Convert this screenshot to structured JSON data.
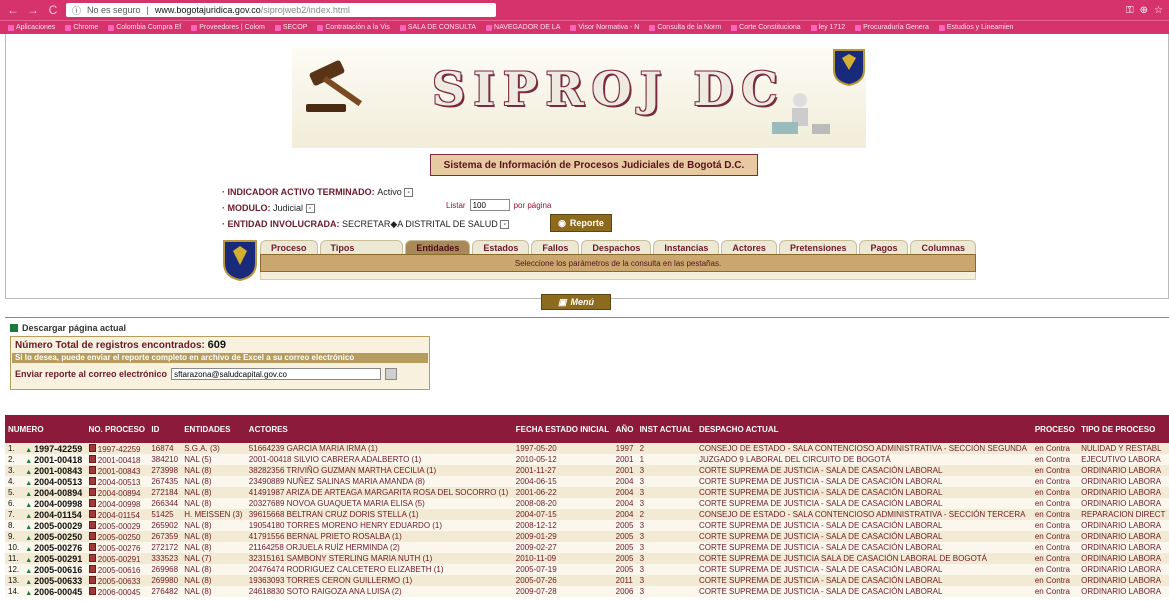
{
  "browser": {
    "security_label": "No es seguro",
    "url_host": "www.bogotajuridica.gov.co",
    "url_path": "/siprojweb2/index.html",
    "bookmarks": [
      "Aplicaciones",
      "Chrome",
      "Colombia Compra Ef",
      "Proveedores | Colom",
      "SECOP",
      "Contratación a la Vis",
      "SALA DE CONSULTA",
      "NAVEGADOR DE LA",
      "Visor Normativa - N",
      "Consulta de la Norm",
      "Corte Constituciona",
      "ley 1712",
      "Procuraduría Genera",
      "Estudios y Lineamien"
    ]
  },
  "header": {
    "logo_text": "SIPROJ DC",
    "subtitle": "Sistema de Información de Procesos Judiciales de Bogotá D.C."
  },
  "filters": {
    "indicador_label": "INDICADOR ACTIVO TERMINADO:",
    "indicador_value": "Activo",
    "modulo_label": "MODULO:",
    "modulo_value": "Judicial",
    "entidad_label": "ENTIDAD INVOLUCRADA:",
    "entidad_value": "SECRETAR◆A DISTRITAL DE SALUD",
    "listar_label": "Listar",
    "listar_value": "100",
    "por_pagina": "por página",
    "report_button": "Reporte"
  },
  "tabs": {
    "items": [
      "Proceso",
      "Tipos Proceso",
      "Entidades",
      "Estados",
      "Fallos",
      "Despachos",
      "Instancias",
      "Actores",
      "Pretensiones",
      "Pagos",
      "Columnas"
    ],
    "active": "Entidades",
    "hint": "Seleccione los parámetros de la consulta en las pestañas."
  },
  "menu_button": "Menú",
  "download": {
    "label": "Descargar página actual",
    "total_label": "Número Total de registros encontrados:",
    "total_value": "609",
    "note": "Si lo desea, puede enviar el reporte completo en archivo de Excel a su correo electrónico",
    "email_label": "Enviar reporte al correo electrónico",
    "email_value": "sftarazona@saludcapital.gov.co"
  },
  "table": {
    "headers": [
      "NUMERO",
      "NO. PROCESO",
      "ID",
      "ENTIDADES",
      "ACTORES",
      "FECHA ESTADO INICIAL",
      "AÑO",
      "INST ACTUAL",
      "DESPACHO ACTUAL",
      "PROCESO",
      "TIPO DE PROCESO"
    ],
    "rows": [
      {
        "idx": "1.",
        "numero": "1997-42259",
        "proceso": "1997-42259",
        "id": "16874",
        "entidades": "S.G.A. (3)",
        "actores": "51664239 GARCIA MARIA IRMA (1)",
        "fecha": "1997-05-20",
        "anio": "1997",
        "inst": "2",
        "despacho": "CONSEJO DE ESTADO - SALA CONTENCIOSO ADMINISTRATIVA - SECCIÓN SEGUNDA",
        "proc": "en Contra",
        "tipo": "NULIDAD Y RESTABL"
      },
      {
        "idx": "2.",
        "numero": "2001-00418",
        "proceso": "2001-00418",
        "id": "384210",
        "entidades": "NAL (5)",
        "actores": "2001-00418 SILVIO CABRERA ADALBERTO (1)",
        "fecha": "2010-05-12",
        "anio": "2001",
        "inst": "1",
        "despacho": "JUZGADO 9 LABORAL DEL CIRCUITO DE BOGOTÁ",
        "proc": "en Contra",
        "tipo": "EJECUTIVO LABORA"
      },
      {
        "idx": "3.",
        "numero": "2001-00843",
        "proceso": "2001-00843",
        "id": "273998",
        "entidades": "NAL (8)",
        "actores": "38282356 TRIVIÑO GUZMAN MARTHA CECILIA (1)",
        "fecha": "2001-11-27",
        "anio": "2001",
        "inst": "3",
        "despacho": "CORTE SUPREMA DE JUSTICIA - SALA DE CASACIÓN LABORAL",
        "proc": "en Contra",
        "tipo": "ORDINARIO LABORA"
      },
      {
        "idx": "4.",
        "numero": "2004-00513",
        "proceso": "2004-00513",
        "id": "267435",
        "entidades": "NAL (8)",
        "actores": "23490889 NUÑEZ SALINAS MARIA AMANDA (8)",
        "fecha": "2004-06-15",
        "anio": "2004",
        "inst": "3",
        "despacho": "CORTE SUPREMA DE JUSTICIA - SALA DE CASACIÓN LABORAL",
        "proc": "en Contra",
        "tipo": "ORDINARIO LABORA"
      },
      {
        "idx": "5.",
        "numero": "2004-00894",
        "proceso": "2004-00894",
        "id": "272184",
        "entidades": "NAL (8)",
        "actores": "41491987 ARIZA DE ARTEAGA MARGARITA ROSA DEL SOCORRO (1)",
        "fecha": "2001-06-22",
        "anio": "2004",
        "inst": "3",
        "despacho": "CORTE SUPREMA DE JUSTICIA - SALA DE CASACIÓN LABORAL",
        "proc": "en Contra",
        "tipo": "ORDINARIO LABORA"
      },
      {
        "idx": "6.",
        "numero": "2004-00998",
        "proceso": "2004-00998",
        "id": "266344",
        "entidades": "NAL (8)",
        "actores": "20327689 NOVOA GUAQUETA MARIA ELISA (5)",
        "fecha": "2008-08-20",
        "anio": "2004",
        "inst": "3",
        "despacho": "CORTE SUPREMA DE JUSTICIA - SALA DE CASACIÓN LABORAL",
        "proc": "en Contra",
        "tipo": "ORDINARIO LABORA"
      },
      {
        "idx": "7.",
        "numero": "2004-01154",
        "proceso": "2004-01154",
        "id": "51425",
        "entidades": "H. MEISSEN (3)",
        "actores": "39615668 BELTRAN CRUZ DORIS STELLA (1)",
        "fecha": "2004-07-15",
        "anio": "2004",
        "inst": "2",
        "despacho": "CONSEJO DE ESTADO - SALA CONTENCIOSO ADMINISTRATIVA - SECCIÓN TERCERA",
        "proc": "en Contra",
        "tipo": "REPARACION DIRECT"
      },
      {
        "idx": "8.",
        "numero": "2005-00029",
        "proceso": "2005-00029",
        "id": "265902",
        "entidades": "NAL (8)",
        "actores": "19054180 TORRES MORENO HENRY EDUARDO (1)",
        "fecha": "2008-12-12",
        "anio": "2005",
        "inst": "3",
        "despacho": "CORTE SUPREMA DE JUSTICIA - SALA DE CASACIÓN LABORAL",
        "proc": "en Contra",
        "tipo": "ORDINARIO LABORA"
      },
      {
        "idx": "9.",
        "numero": "2005-00250",
        "proceso": "2005-00250",
        "id": "267359",
        "entidades": "NAL (8)",
        "actores": "41791556 BERNAL PRIETO ROSALBA (1)",
        "fecha": "2009-01-29",
        "anio": "2005",
        "inst": "3",
        "despacho": "CORTE SUPREMA DE JUSTICIA - SALA DE CASACIÓN LABORAL",
        "proc": "en Contra",
        "tipo": "ORDINARIO LABORA"
      },
      {
        "idx": "10.",
        "numero": "2005-00276",
        "proceso": "2005-00276",
        "id": "272172",
        "entidades": "NAL (8)",
        "actores": "21164258 ORJUELA RUÍZ HERMINDA (2)",
        "fecha": "2009-02-27",
        "anio": "2005",
        "inst": "3",
        "despacho": "CORTE SUPREMA DE JUSTICIA - SALA DE CASACIÓN LABORAL",
        "proc": "en Contra",
        "tipo": "ORDINARIO LABORA"
      },
      {
        "idx": "11.",
        "numero": "2005-00291",
        "proceso": "2005-00291",
        "id": "333523",
        "entidades": "NAL (7)",
        "actores": "32315161 SAMBONY STERLING MARIA NUTH (1)",
        "fecha": "2010-11-09",
        "anio": "2005",
        "inst": "3",
        "despacho": "CORTE SUPREMA DE JUSTICIA SALA DE CASACIÓN LABORAL DE BOGOTÁ",
        "proc": "en Contra",
        "tipo": "ORDINARIO LABORA"
      },
      {
        "idx": "12.",
        "numero": "2005-00616",
        "proceso": "2005-00616",
        "id": "269968",
        "entidades": "NAL (8)",
        "actores": "20476474 RODRIGUEZ CALCETERO ELIZABETH (1)",
        "fecha": "2005-07-19",
        "anio": "2005",
        "inst": "3",
        "despacho": "CORTE SUPREMA DE JUSTICIA - SALA DE CASACIÓN LABORAL",
        "proc": "en Contra",
        "tipo": "ORDINARIO LABORA"
      },
      {
        "idx": "13.",
        "numero": "2005-00633",
        "proceso": "2005-00633",
        "id": "269980",
        "entidades": "NAL (8)",
        "actores": "19363093 TORRES CERON GUILLERMO (1)",
        "fecha": "2005-07-26",
        "anio": "2011",
        "inst": "3",
        "despacho": "CORTE SUPREMA DE JUSTICIA - SALA DE CASACIÓN LABORAL",
        "proc": "en Contra",
        "tipo": "ORDINARIO LABORA"
      },
      {
        "idx": "14.",
        "numero": "2006-00045",
        "proceso": "2006-00045",
        "id": "276482",
        "entidades": "NAL (8)",
        "actores": "24618830 SOTO RAIGOZA ANA LUISA (2)",
        "fecha": "2009-07-28",
        "anio": "2006",
        "inst": "3",
        "despacho": "CORTE SUPREMA DE JUSTICIA - SALA DE CASACIÓN LABORAL",
        "proc": "en Contra",
        "tipo": "ORDINARIO LABORA"
      }
    ]
  }
}
